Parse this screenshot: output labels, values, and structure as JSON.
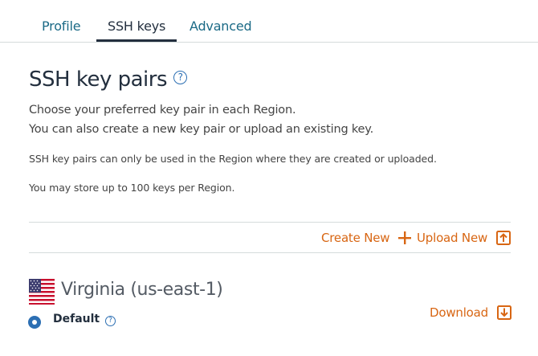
{
  "tabs": [
    {
      "label": "Profile",
      "active": false
    },
    {
      "label": "SSH keys",
      "active": true
    },
    {
      "label": "Advanced",
      "active": false
    }
  ],
  "section": {
    "title": "SSH key pairs",
    "help_icon": "question-circle-icon",
    "description_lines": [
      "Choose your preferred key pair in each Region.",
      "You can also create a new key pair or upload an existing key."
    ],
    "notes": [
      "SSH key pairs can only be used in the Region where they are created or uploaded.",
      "You may store up to 100 keys per Region."
    ]
  },
  "actions": {
    "create_new": "Create New",
    "create_icon": "plus-icon",
    "upload_new": "Upload New",
    "upload_icon": "upload-icon"
  },
  "region": {
    "flag_icon": "us-flag-icon",
    "name": "Virginia (us-east-1)",
    "default_label": "Default",
    "default_selected": true,
    "download_label": "Download",
    "download_icon": "download-icon"
  },
  "colors": {
    "accent_orange": "#d86613",
    "link_blue": "#1b6a86",
    "help_blue": "#2c6fb3",
    "text_dark": "#232f3e"
  }
}
